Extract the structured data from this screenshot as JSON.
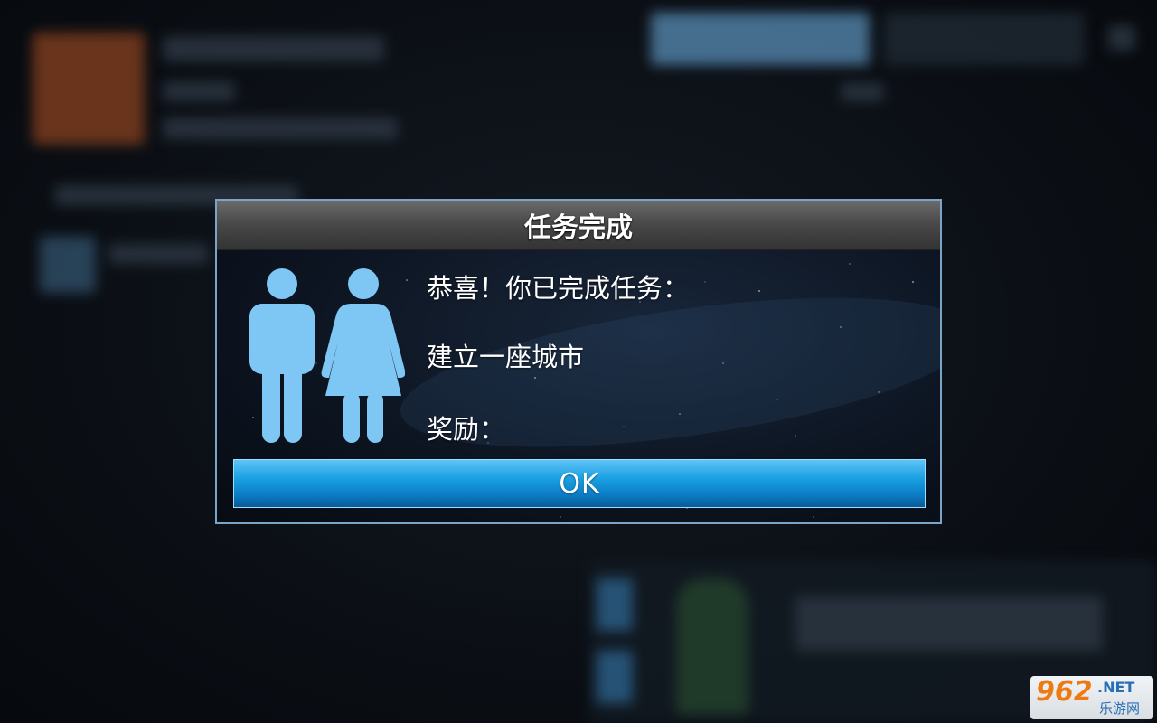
{
  "dialog": {
    "title": "任务完成",
    "line1": "恭喜！你已完成任务：",
    "line2": "建立一座城市",
    "line3": "奖励：",
    "ok_label": "OK",
    "icon": "restroom-people-icon"
  },
  "watermark": {
    "number": "962",
    "net": ".NET",
    "sub": "乐游网"
  },
  "colors": {
    "dialog_border": "#7aa5c8",
    "figure": "#7ec6f4",
    "ok_button": "#1a9fe2",
    "title_bar": "#4a4a4a"
  }
}
